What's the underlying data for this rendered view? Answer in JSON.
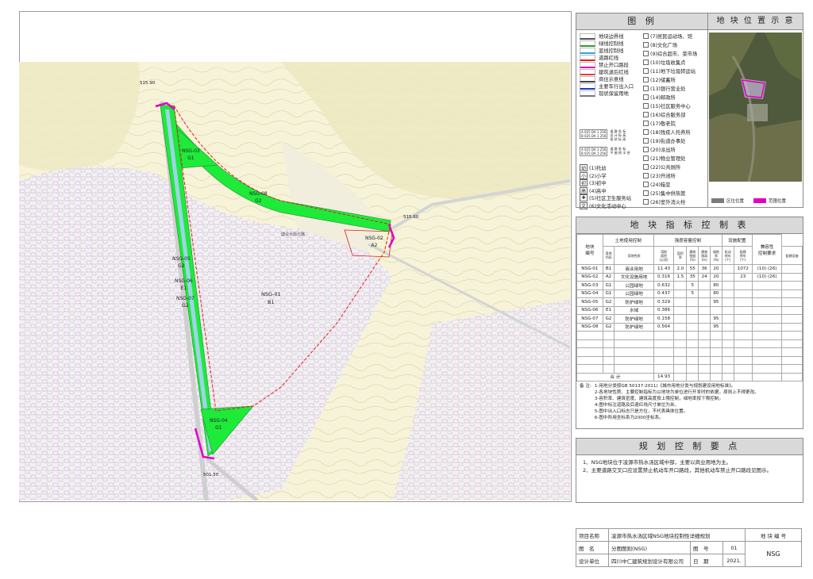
{
  "legend": {
    "title": "图 例",
    "lines": [
      {
        "label": "地块边界线",
        "color": "#555555"
      },
      {
        "label": "绿线控制线",
        "color": "#2e9b2e"
      },
      {
        "label": "蓝线控制线",
        "color": "#3aa0e0"
      },
      {
        "label": "道路红线",
        "color": "#e02020"
      },
      {
        "label": "禁止开口路段",
        "color": "#e000c8"
      },
      {
        "label": "建筑退后红线",
        "color": "#e04040"
      },
      {
        "label": "商住示意线",
        "color": "#444444"
      },
      {
        "label": "主要车行出入口",
        "color": "#1a3bd0"
      },
      {
        "label": "现状保留用地",
        "color": "#777777"
      }
    ],
    "road_notes": [
      {
        "code": "A 025 DA 1 256\nB 025 DA 1 256",
        "label": "道 路 坐 标\n设 计 标 高\n现 状 标 高"
      },
      {
        "code": "A 025 DA 1 256\nB 025 DA 1 256",
        "label": "道 路 坐 标\n平 曲 线 半 径"
      }
    ],
    "facilities_left": [
      {
        "sym": "幼",
        "label": "(1)托幼"
      },
      {
        "sym": "小",
        "label": "(2)小学"
      },
      {
        "sym": "初",
        "label": "(3)初中"
      },
      {
        "sym": "高",
        "label": "(4)高中"
      },
      {
        "sym": "✚",
        "label": "(5)社区卫生服务站"
      },
      {
        "sym": "文",
        "label": "(6)文化活动中心"
      }
    ],
    "facilities_right": [
      "(7)居民运动场、馆",
      "(8)文化广场",
      "(9)综合超市、菜市场",
      "(10)垃圾收集点",
      "(11)地下垃圾转运站",
      "(12)储蓄所",
      "(13)银行营业处",
      "(14)邮政所",
      "(15)社区服务中心",
      "(16)综合服务部",
      "(17)敬老院",
      "(18)残疾人托养所",
      "(19)街道办事处",
      "(20)派出所",
      "(21)物业管理处",
      "(22)公共厕所",
      "(23)开闭所",
      "(24)箱变",
      "(25)集中供热管",
      "(26)室外消火栓"
    ]
  },
  "location": {
    "title": "地 块 位 置 示 意",
    "legend": [
      {
        "label": "区位位置",
        "color": "#7a7a7a"
      },
      {
        "label": "范围位置",
        "color": "#e000c8"
      }
    ]
  },
  "control_table": {
    "title": "地 块 指 标 控 制 表",
    "group_headers": [
      "地块\n编号",
      "土地使用控制",
      "强度容量控制",
      "设施配置",
      "兼容性\n控制要求"
    ],
    "sub_headers": [
      "用地\n代码",
      "用地性质",
      "用地\n面积\n(公顷)",
      "容积\n率",
      "建筑\n密度\n(%)",
      "建筑\n限高\n(m)",
      "绿地\n率\n(%)",
      "机动\n停车\n(个)",
      "配建\n停车\n(个)",
      "配建设施"
    ],
    "rows": [
      [
        "NSG-01",
        "B1",
        "商业用地",
        "11.43",
        "2.0",
        "55",
        "36",
        "20",
        "",
        "1072",
        "(10) (26)",
        ""
      ],
      [
        "NSG-02",
        "A2",
        "文化设施用地",
        "0.316",
        "1.5",
        "35",
        "24",
        "20",
        "",
        "23",
        "(10) (26)",
        ""
      ],
      [
        "NSG-03",
        "G1",
        "公园绿地",
        "0.632",
        "",
        "5",
        "",
        "80",
        "",
        "",
        "",
        ""
      ],
      [
        "NSG-04",
        "G1",
        "公园绿地",
        "0.437",
        "",
        "5",
        "",
        "80",
        "",
        "",
        "",
        ""
      ],
      [
        "NSG-05",
        "G2",
        "防护绿地",
        "0.329",
        "",
        "",
        "",
        "95",
        "",
        "",
        "",
        ""
      ],
      [
        "NSG-06",
        "E1",
        "水域",
        "0.386",
        "",
        "",
        "",
        "",
        "",
        "",
        "",
        ""
      ],
      [
        "NSG-07",
        "G2",
        "防护绿地",
        "0.158",
        "",
        "",
        "",
        "95",
        "",
        "",
        "",
        ""
      ],
      [
        "NSG-08",
        "G2",
        "防护绿地",
        "0.564",
        "",
        "",
        "",
        "95",
        "",
        "",
        "",
        ""
      ]
    ],
    "total_label": "合 计",
    "total_value": "14.93",
    "notes_label": "备 注:",
    "notes": [
      "1-用地分类按GB 50137-2011)《城市用地分类与规划建设用地标准》。",
      "2-各地块性质、主要控制指标为以地块为单位进行开发时的依据，原则上不得更改。",
      "3-容积率、建筑密度、建筑高度按上限控制，绿地率按下限控制。",
      "4-图中标注道路及后退红线尺寸单位为米。",
      "5-图中出入口标志只是方位，不代表具体位置。",
      "6-图中所用坐标系为2000坐标系。"
    ]
  },
  "requirements": {
    "title": "规 划 控 制 要 点",
    "items": [
      "1、NSG地块位于凌源市热水汤区域中部，主要以商业用地为主。",
      "2、主要道路交叉口应设置禁止机动车开口路段，其他机动车禁止开口路段见图示。"
    ]
  },
  "title_block": {
    "project_label": "项目名称",
    "project": "凌源市热水汤区域NSG地块控制性详细规划",
    "drawing_label": "图　名",
    "drawing": "分图图则(NSG)",
    "number_label": "图　号",
    "number": "01",
    "designer_label": "设计单位",
    "designer": "四川中仁建筑规划设计有限公司",
    "date_label": "日　期",
    "date": "2021.",
    "block_code_label": "地 块 编 号",
    "block_code": "NSG"
  },
  "map": {
    "parcels": [
      {
        "id": "NSG-03",
        "code": "G1"
      },
      {
        "id": "NSG-08",
        "code": "G2"
      },
      {
        "id": "NSG-02",
        "code": "A2"
      },
      {
        "id": "NSG-05",
        "code": "G2"
      },
      {
        "id": "NSG-06",
        "code": "E1"
      },
      {
        "id": "NSG-07",
        "code": "G2"
      },
      {
        "id": "NSG-01",
        "code": "B1"
      },
      {
        "id": "NSG-04",
        "code": "G1"
      }
    ],
    "elevations": [
      "515.90",
      "515.60",
      "501.50"
    ],
    "road_label": "建设大街北路"
  },
  "colors": {
    "green": "#1eea3a",
    "river": "#9ed4e6",
    "magenta": "#e000c8",
    "red": "#e02020",
    "header": "#d9d9d9"
  }
}
